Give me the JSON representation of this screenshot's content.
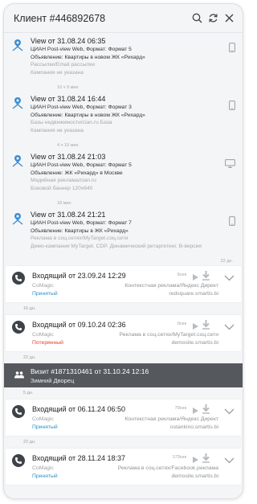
{
  "header": {
    "title": "Клиент #446892678",
    "icons": [
      "search-icon",
      "refresh-icon",
      "close-icon"
    ]
  },
  "views": [
    {
      "title": "View от 31.08.24 06:35",
      "lines": [
        "ЦИАН Post-view Web, Формат: Формат 5",
        "Объявление: Квартиры в новом ЖК «Рихард»"
      ],
      "gray": [
        "Рассылки/Email рассылки",
        "Кампания не указана"
      ],
      "gap": "10 ч 9 мин",
      "device": "mobile"
    },
    {
      "title": "View от 31.08.24 16:44",
      "lines": [
        "ЦИАН Post-view Web, Формат: Формат 3",
        "Объявление: Квартиры в новом ЖК «Рихард»"
      ],
      "gray": [
        "Базы недвижимости/cian.ru База",
        "Кампания не указана"
      ],
      "gap": "4 ч 19 мин",
      "device": "mobile"
    },
    {
      "title": "View от 31.08.24 21:03",
      "lines": [
        "ЦИАН Post-view Web, Формат: Формат 5",
        "Объявление: ЖК «Рихард» в Москве"
      ],
      "gray": [
        "Медийная реклама/cian.ru",
        "Боковой баннер 120х640"
      ],
      "gap": "18 мин",
      "device": "desktop"
    },
    {
      "title": "View от 31.08.24 21:21",
      "lines": [
        "ЦИАН Post-view Web, Формат: Формат 7",
        "Объявление: Квартиры в ЖК «Рихард»"
      ],
      "gray": [
        "Реклама в соц.сетях/MyTarget.соц.сети",
        "Демо-кампания MyTarget. CDP. Динамический ретаргетинг. В-версия"
      ],
      "gap": "22 дн.",
      "device": "mobile"
    }
  ],
  "calls_1": [
    {
      "title": "Входящий от 23.09.24 12:29",
      "duration": "6сек",
      "source": "CoMagic",
      "status": "Принятый",
      "status_color": "#2f8fc4",
      "channel": "Контекстная реклама/Яндекс Директ",
      "site": "redsquare.smartis.bi"
    }
  ],
  "sep1": "16 дн.",
  "calls_2": [
    {
      "title": "Входящий от 09.10.24 02:36",
      "duration": "0сек",
      "source": "CoMagic",
      "status": "Потерянный",
      "status_color": "#e0452d",
      "channel": "Реклама в соц.сетях/MyTarget.соц.сети",
      "site": "demosite.smartis.bi"
    }
  ],
  "sep2": "22 дн.",
  "visit": {
    "title": "Визит #1871310461 от 31.10.24 12:16",
    "place": "Зимний Дворец"
  },
  "sep3": "5 дн.",
  "calls_3": [
    {
      "title": "Входящий от 06.11.24 06:50",
      "duration": "79сек",
      "source": "CoMagic",
      "status": "Принятый",
      "status_color": "#2f8fc4",
      "channel": "Контекстная реклама/Яндекс Директ",
      "site": "ostankino.smartis.bi"
    }
  ],
  "sep4": "22 дн.",
  "calls_4": [
    {
      "title": "Входящий от 28.11.24 18:37",
      "duration": "173сек",
      "source": "CoMagic",
      "status": "Принятый",
      "status_color": "#2f8fc4",
      "channel": "Реклама в соц.сетях/Facebook.реклама",
      "site": "demosite.smartis.bi"
    }
  ]
}
